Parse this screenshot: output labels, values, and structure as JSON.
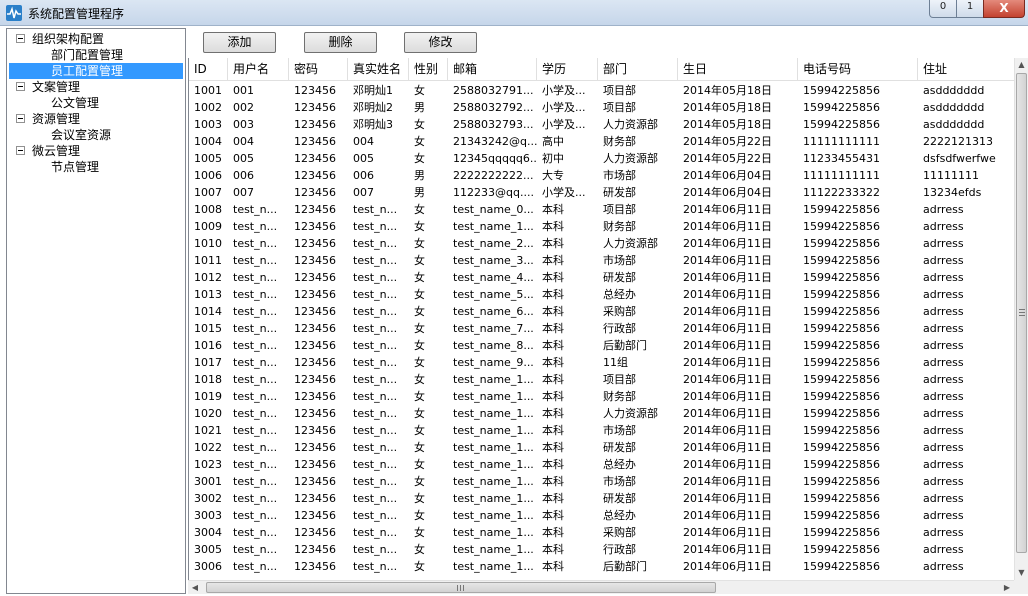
{
  "window": {
    "title": "系统配置管理程序",
    "min_label": "0",
    "max_label": "1",
    "close_label": "X"
  },
  "toolbar": {
    "add_label": "添加",
    "delete_label": "删除",
    "edit_label": "修改"
  },
  "tree": [
    {
      "label": "组织架构配置",
      "children": [
        {
          "label": "部门配置管理",
          "selected": false
        },
        {
          "label": "员工配置管理",
          "selected": true
        }
      ]
    },
    {
      "label": "文案管理",
      "children": [
        {
          "label": "公文管理",
          "selected": false
        }
      ]
    },
    {
      "label": "资源管理",
      "children": [
        {
          "label": "会议室资源",
          "selected": false
        }
      ]
    },
    {
      "label": "微云管理",
      "children": [
        {
          "label": "节点管理",
          "selected": false
        }
      ]
    }
  ],
  "table": {
    "columns": [
      "ID",
      "用户名",
      "密码",
      "真实姓名",
      "性别",
      "邮箱",
      "学历",
      "部门",
      "生日",
      "电话号码",
      "住址"
    ],
    "rows": [
      [
        "1001",
        "001",
        "123456",
        "邓明灿1",
        "女",
        "2588032791...",
        "小学及...",
        "项目部",
        "2014年05月18日",
        "15994225856",
        "asddddddd"
      ],
      [
        "1002",
        "002",
        "123456",
        "邓明灿2",
        "男",
        "2588032792...",
        "小学及...",
        "项目部",
        "2014年05月18日",
        "15994225856",
        "asddddddd"
      ],
      [
        "1003",
        "003",
        "123456",
        "邓明灿3",
        "女",
        "2588032793...",
        "小学及...",
        "人力资源部",
        "2014年05月18日",
        "15994225856",
        "asddddddd"
      ],
      [
        "1004",
        "004",
        "123456",
        "004",
        "女",
        "21343242@q...",
        "高中",
        "财务部",
        "2014年05月22日",
        "11111111111",
        "2222121313"
      ],
      [
        "1005",
        "005",
        "123456",
        "005",
        "女",
        "12345qqqqq6...",
        "初中",
        "人力资源部",
        "2014年05月22日",
        "11233455431",
        "dsfsdfwerfwe"
      ],
      [
        "1006",
        "006",
        "123456",
        "006",
        "男",
        "2222222222...",
        "大专",
        "市场部",
        "2014年06月04日",
        "11111111111",
        "11111111"
      ],
      [
        "1007",
        "007",
        "123456",
        "007",
        "男",
        "112233@qq....",
        "小学及...",
        "研发部",
        "2014年06月04日",
        "11122233322",
        "13234efds"
      ],
      [
        "1008",
        "test_n...",
        "123456",
        "test_n...",
        "女",
        "test_name_0...",
        "本科",
        "项目部",
        "2014年06月11日",
        "15994225856",
        "adrress"
      ],
      [
        "1009",
        "test_n...",
        "123456",
        "test_n...",
        "女",
        "test_name_1...",
        "本科",
        "财务部",
        "2014年06月11日",
        "15994225856",
        "adrress"
      ],
      [
        "1010",
        "test_n...",
        "123456",
        "test_n...",
        "女",
        "test_name_2...",
        "本科",
        "人力资源部",
        "2014年06月11日",
        "15994225856",
        "adrress"
      ],
      [
        "1011",
        "test_n...",
        "123456",
        "test_n...",
        "女",
        "test_name_3...",
        "本科",
        "市场部",
        "2014年06月11日",
        "15994225856",
        "adrress"
      ],
      [
        "1012",
        "test_n...",
        "123456",
        "test_n...",
        "女",
        "test_name_4...",
        "本科",
        "研发部",
        "2014年06月11日",
        "15994225856",
        "adrress"
      ],
      [
        "1013",
        "test_n...",
        "123456",
        "test_n...",
        "女",
        "test_name_5...",
        "本科",
        "总经办",
        "2014年06月11日",
        "15994225856",
        "adrress"
      ],
      [
        "1014",
        "test_n...",
        "123456",
        "test_n...",
        "女",
        "test_name_6...",
        "本科",
        "采购部",
        "2014年06月11日",
        "15994225856",
        "adrress"
      ],
      [
        "1015",
        "test_n...",
        "123456",
        "test_n...",
        "女",
        "test_name_7...",
        "本科",
        "行政部",
        "2014年06月11日",
        "15994225856",
        "adrress"
      ],
      [
        "1016",
        "test_n...",
        "123456",
        "test_n...",
        "女",
        "test_name_8...",
        "本科",
        "后勤部门",
        "2014年06月11日",
        "15994225856",
        "adrress"
      ],
      [
        "1017",
        "test_n...",
        "123456",
        "test_n...",
        "女",
        "test_name_9...",
        "本科",
        "11组",
        "2014年06月11日",
        "15994225856",
        "adrress"
      ],
      [
        "1018",
        "test_n...",
        "123456",
        "test_n...",
        "女",
        "test_name_1...",
        "本科",
        "项目部",
        "2014年06月11日",
        "15994225856",
        "adrress"
      ],
      [
        "1019",
        "test_n...",
        "123456",
        "test_n...",
        "女",
        "test_name_1...",
        "本科",
        "财务部",
        "2014年06月11日",
        "15994225856",
        "adrress"
      ],
      [
        "1020",
        "test_n...",
        "123456",
        "test_n...",
        "女",
        "test_name_1...",
        "本科",
        "人力资源部",
        "2014年06月11日",
        "15994225856",
        "adrress"
      ],
      [
        "1021",
        "test_n...",
        "123456",
        "test_n...",
        "女",
        "test_name_1...",
        "本科",
        "市场部",
        "2014年06月11日",
        "15994225856",
        "adrress"
      ],
      [
        "1022",
        "test_n...",
        "123456",
        "test_n...",
        "女",
        "test_name_1...",
        "本科",
        "研发部",
        "2014年06月11日",
        "15994225856",
        "adrress"
      ],
      [
        "1023",
        "test_n...",
        "123456",
        "test_n...",
        "女",
        "test_name_1...",
        "本科",
        "总经办",
        "2014年06月11日",
        "15994225856",
        "adrress"
      ],
      [
        "3001",
        "test_n...",
        "123456",
        "test_n...",
        "女",
        "test_name_1...",
        "本科",
        "市场部",
        "2014年06月11日",
        "15994225856",
        "adrress"
      ],
      [
        "3002",
        "test_n...",
        "123456",
        "test_n...",
        "女",
        "test_name_1...",
        "本科",
        "研发部",
        "2014年06月11日",
        "15994225856",
        "adrress"
      ],
      [
        "3003",
        "test_n...",
        "123456",
        "test_n...",
        "女",
        "test_name_1...",
        "本科",
        "总经办",
        "2014年06月11日",
        "15994225856",
        "adrress"
      ],
      [
        "3004",
        "test_n...",
        "123456",
        "test_n...",
        "女",
        "test_name_1...",
        "本科",
        "采购部",
        "2014年06月11日",
        "15994225856",
        "adrress"
      ],
      [
        "3005",
        "test_n...",
        "123456",
        "test_n...",
        "女",
        "test_name_1...",
        "本科",
        "行政部",
        "2014年06月11日",
        "15994225856",
        "adrress"
      ],
      [
        "3006",
        "test_n...",
        "123456",
        "test_n...",
        "女",
        "test_name_1...",
        "本科",
        "后勤部门",
        "2014年06月11日",
        "15994225856",
        "adrress"
      ]
    ]
  },
  "colors": {
    "selection": "#3399ff",
    "title_bar": "#c6d6ea",
    "close_button": "#c3422f"
  },
  "icons": {
    "app": "app-logo-icon",
    "minimize": "minimize-icon",
    "maximize": "maximize-icon",
    "close": "close-icon"
  }
}
